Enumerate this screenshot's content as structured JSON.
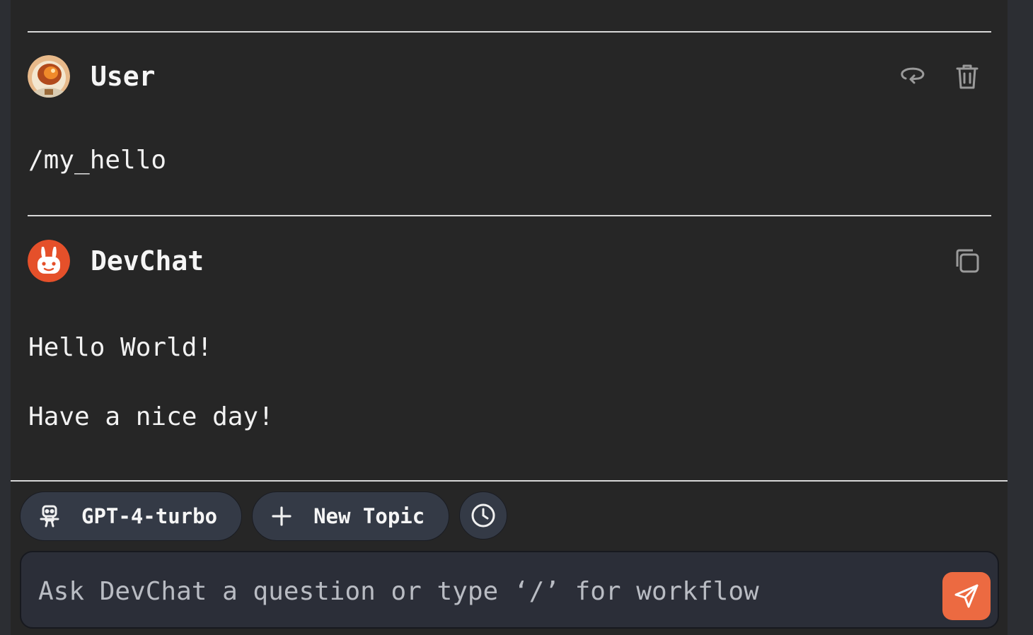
{
  "messages": [
    {
      "author": "User",
      "text": "/my_hello",
      "avatar_icon": "astronaut-avatar-icon",
      "actions": [
        "undo-arrow-icon",
        "trash-icon"
      ]
    },
    {
      "author": "DevChat",
      "text": "Hello World!\n\nHave a nice day!",
      "avatar_icon": "devchat-bunny-logo-icon",
      "actions": [
        "copy-icon"
      ]
    }
  ],
  "toolbar": {
    "model_label": "GPT-4-turbo",
    "new_topic_label": "New Topic",
    "history_icon": "clock-icon"
  },
  "input": {
    "placeholder": "Ask DevChat a question or type ‘/’ for workflow",
    "value": ""
  },
  "colors": {
    "background": "#262626",
    "accent": "#ec6a41",
    "pill": "#343a46",
    "text": "#f2f2f2"
  }
}
